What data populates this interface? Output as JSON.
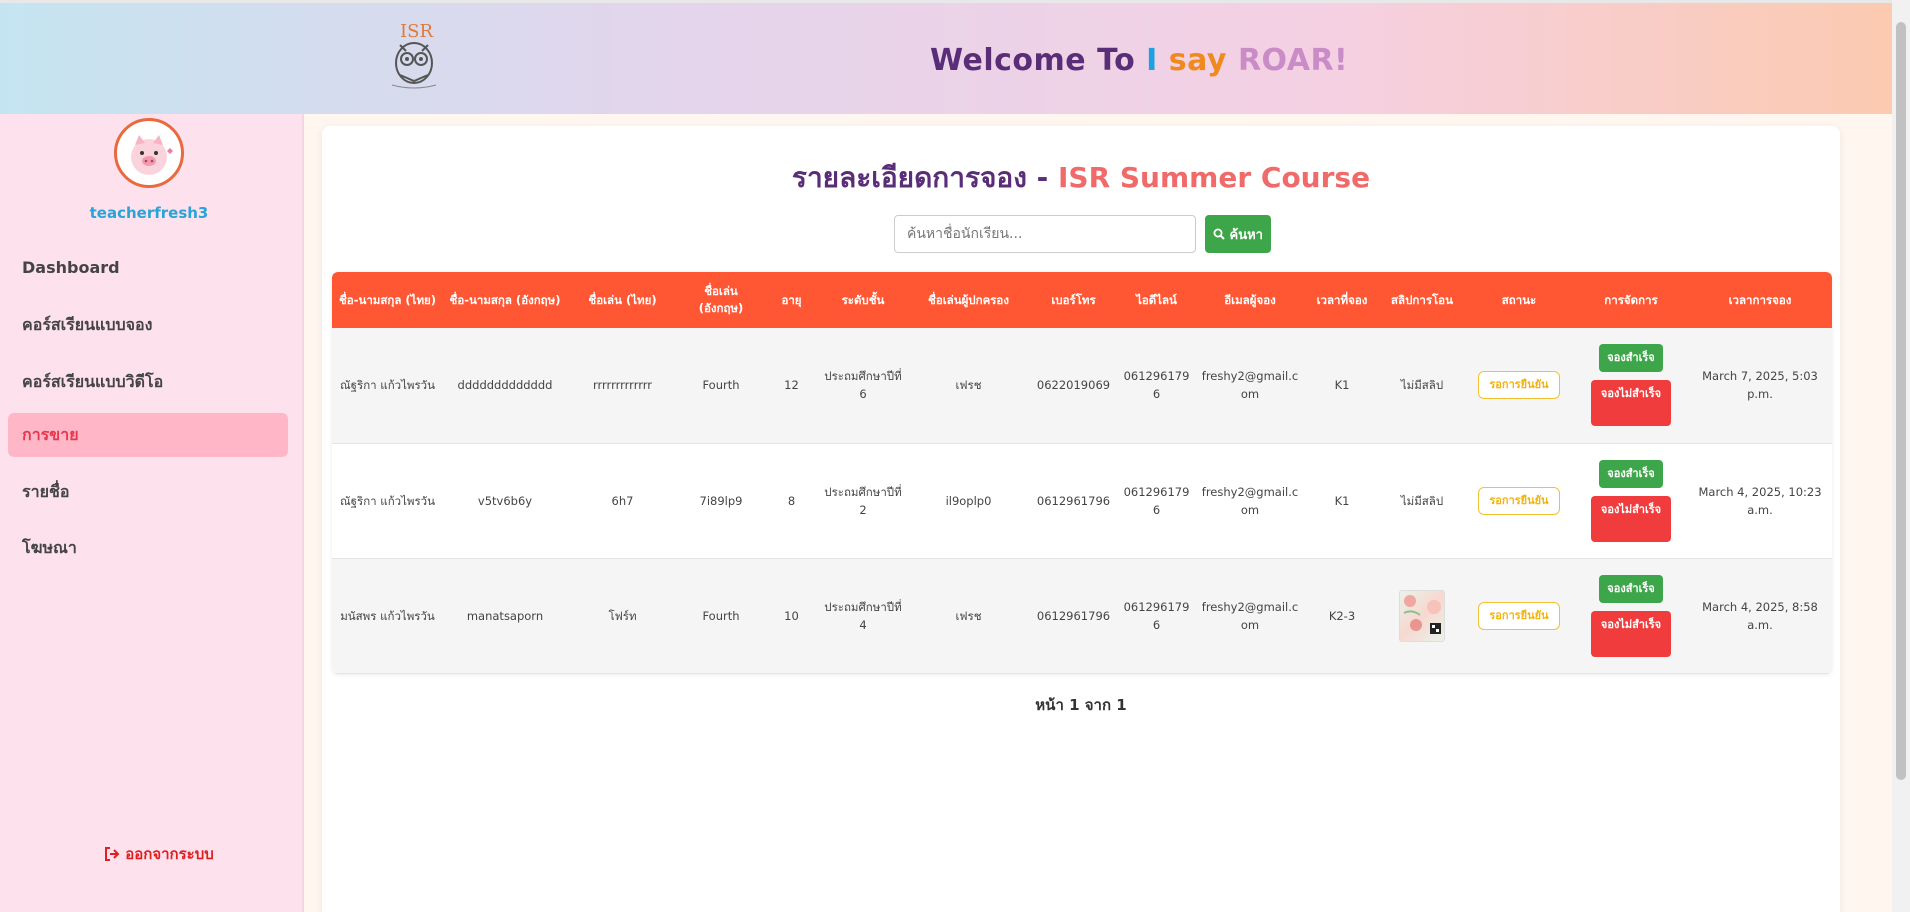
{
  "header": {
    "welcome_prefix": "Welcome To ",
    "welcome_i": "I",
    "welcome_say": " say ",
    "welcome_roar": "ROAR!",
    "logo_text": "ISR"
  },
  "sidebar": {
    "username": "teacherfresh3",
    "items": [
      {
        "label": "Dashboard"
      },
      {
        "label": "คอร์สเรียนแบบจอง"
      },
      {
        "label": "คอร์สเรียนแบบวิดีโอ"
      },
      {
        "label": "การขาย"
      },
      {
        "label": "รายชื่อ"
      },
      {
        "label": "โฆษณา"
      }
    ],
    "logout_label": "ออกจากระบบ"
  },
  "main": {
    "title_prefix": "รายละเอียดการจอง - ",
    "title_course": "ISR Summer Course",
    "search_placeholder": "ค้นหาชื่อนักเรียน...",
    "search_button": "ค้นหา",
    "pagination": "หน้า 1 จาก 1"
  },
  "table": {
    "headers": [
      "ชื่อ-นามสกุล (ไทย)",
      "ชื่อ-นามสกุล (อังกฤษ)",
      "ชื่อเล่น (ไทย)",
      "ชื่อเล่น (อังกฤษ)",
      "อายุ",
      "ระดับชั้น",
      "ชื่อเล่นผู้ปกครอง",
      "เบอร์โทร",
      "ไอดีไลน์",
      "อีเมลผู้จอง",
      "เวลาที่จอง",
      "สลิปการโอน",
      "สถานะ",
      "การจัดการ",
      "เวลาการจอง"
    ],
    "rows": [
      {
        "name_th": "ณัฐริกา แก้วไพรวัน",
        "name_en": "ddddddddddddd",
        "nick_th": "rrrrrrrrrrrrr",
        "nick_en": "Fourth",
        "age": "12",
        "level": "ประถมศึกษาปีที่ 6",
        "parent_nick": "เฟรช",
        "phone": "0622019069",
        "line_id": "0612961796",
        "email": "freshy2@gmail.com",
        "slot": "K1",
        "slip": "ไม่มีสลิป",
        "status": "รอการยืนยัน",
        "ok_label": "จองสำเร็จ",
        "fail_label": "จองไม่สำเร็จ",
        "booked_at": "March 7, 2025, 5:03 p.m."
      },
      {
        "name_th": "ณัฐริกา แก้วไพรวัน",
        "name_en": "v5tv6b6y",
        "nick_th": "6h7",
        "nick_en": "7i89lp9",
        "age": "8",
        "level": "ประถมศึกษาปีที่ 2",
        "parent_nick": "il9oplp0",
        "phone": "0612961796",
        "line_id": "0612961796",
        "email": "freshy2@gmail.com",
        "slot": "K1",
        "slip": "ไม่มีสลิป",
        "status": "รอการยืนยัน",
        "ok_label": "จองสำเร็จ",
        "fail_label": "จองไม่สำเร็จ",
        "booked_at": "March 4, 2025, 10:23 a.m."
      },
      {
        "name_th": "มนัสพร แก้วไพรวัน",
        "name_en": "manatsaporn",
        "nick_th": "โฟร์ท",
        "nick_en": "Fourth",
        "age": "10",
        "level": "ประถมศึกษาปีที่ 4",
        "parent_nick": "เฟรช",
        "phone": "0612961796",
        "line_id": "0612961796",
        "email": "freshy2@gmail.com",
        "slot": "K2-3",
        "slip": "",
        "status": "รอการยืนยัน",
        "ok_label": "จองสำเร็จ",
        "fail_label": "จองไม่สำเร็จ",
        "booked_at": "March 4, 2025, 8:58 a.m."
      }
    ]
  },
  "colors": {
    "header_accent": "#ff5733",
    "title_purple": "#5a2d78",
    "title_coral": "#f06a6a",
    "success": "#3ea64a",
    "danger": "#f03c3c",
    "pending": "#f2b410"
  }
}
